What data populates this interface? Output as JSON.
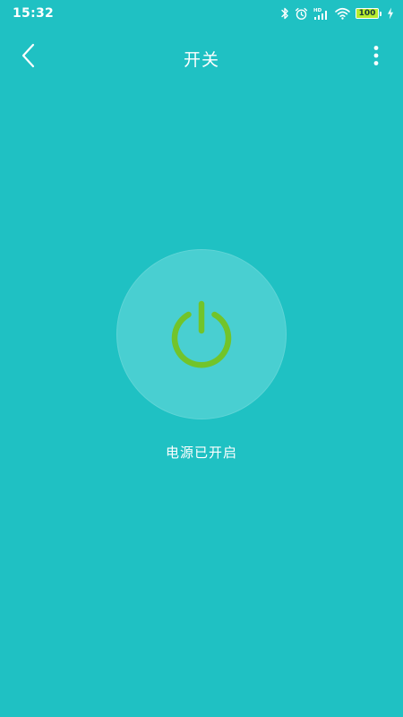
{
  "status_bar": {
    "time": "15:32",
    "battery_level": "100",
    "battery_fraction": 1.0,
    "icons": [
      "bluetooth-icon",
      "alarm-icon",
      "hd-signal-icon",
      "wifi-icon",
      "battery-icon",
      "charging-icon"
    ]
  },
  "header": {
    "title": "开关",
    "back_icon": "chevron-left-icon",
    "more_icon": "more-vertical-icon"
  },
  "power": {
    "status_text": "电源已开启",
    "icon": "power-icon",
    "state_on": true
  },
  "colors": {
    "background": "#1fc1c3",
    "circle": "#49cfd1",
    "power_icon": "#72c42a",
    "battery_fill": "#b7ec2e",
    "text": "#ffffff"
  }
}
